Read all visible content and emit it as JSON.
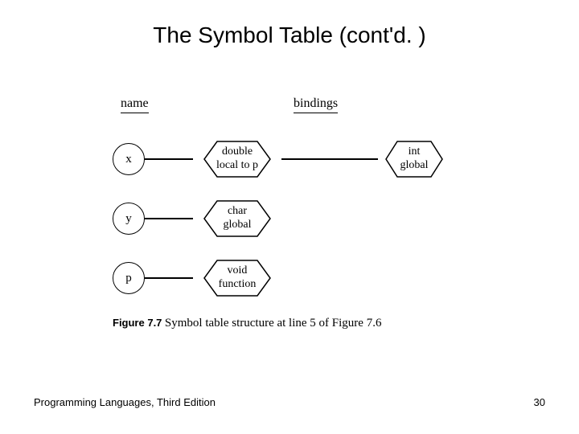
{
  "title": "The Symbol Table (cont'd. )",
  "headers": {
    "name": "name",
    "bindings": "bindings"
  },
  "rows": [
    {
      "sym": "x",
      "b1_line1": "double",
      "b1_line2": "local to p",
      "has_second": true,
      "b2_line1": "int",
      "b2_line2": "global"
    },
    {
      "sym": "y",
      "b1_line1": "char",
      "b1_line2": "global",
      "has_second": false
    },
    {
      "sym": "p",
      "b1_line1": "void",
      "b1_line2": "function",
      "has_second": false
    }
  ],
  "caption": {
    "label": "Figure 7.7",
    "text": "Symbol table structure at line 5 of Figure 7.6"
  },
  "footer": {
    "left": "Programming Languages, Third Edition",
    "right": "30"
  }
}
